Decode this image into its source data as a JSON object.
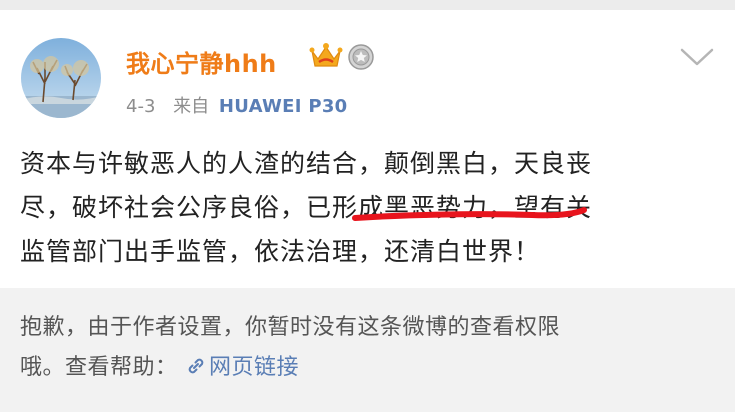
{
  "post": {
    "username": "我心宁静hhh",
    "date": "4-3",
    "from_label": "来自",
    "device": "HUAWEI P30",
    "text_line1": "资本与许敏恶人的人渣的结合，颠倒黑白，天良丧",
    "text_line2": "尽，破坏社会公序良俗，已形成黑恶势力，望有关",
    "text_line3": "监管部门出手监管，依法治理，还清白世界！"
  },
  "notice": {
    "message_line1": "抱歉，由于作者设置，你暂时没有这条微博的查看权限",
    "message_line2": "哦。查看帮助：",
    "link_label": "网页链接"
  },
  "icons": {
    "crown": "crown-icon",
    "medal": "medal-icon",
    "chevron": "chevron-down-icon",
    "link": "link-icon"
  },
  "colors": {
    "username": "#ef7c18",
    "device": "#5a7eb5",
    "link": "#5a7eb5",
    "underline_annotation": "#e8141d",
    "notice_bg": "#f2f2f2"
  }
}
